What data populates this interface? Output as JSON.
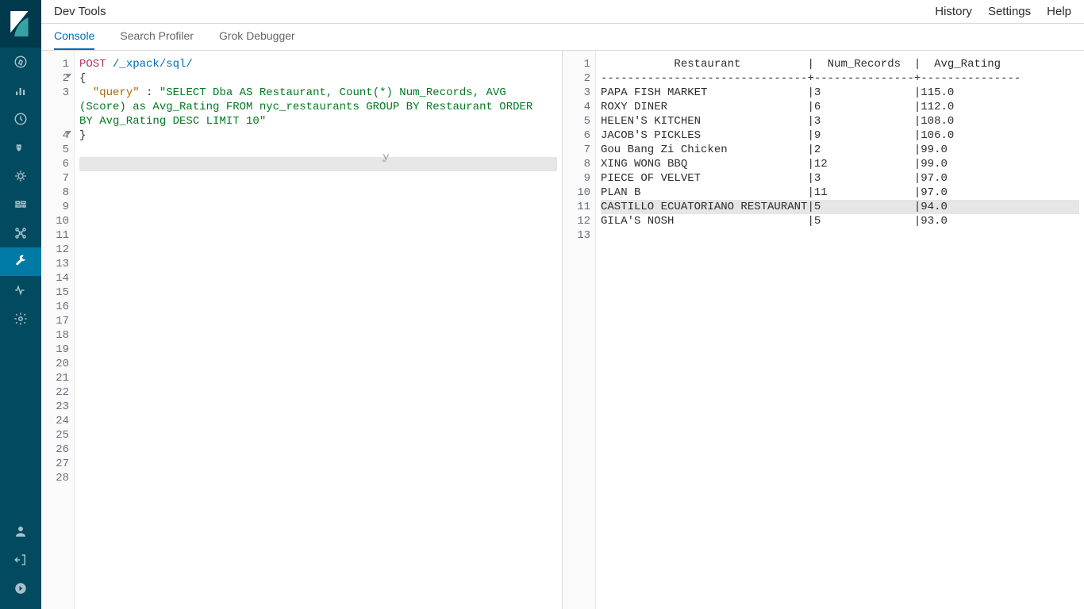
{
  "header": {
    "title": "Dev Tools",
    "links": {
      "history": "History",
      "settings": "Settings",
      "help": "Help"
    }
  },
  "tabs": {
    "console": "Console",
    "search_profiler": "Search Profiler",
    "grok_debugger": "Grok Debugger",
    "active": "console"
  },
  "editor": {
    "method": "POST",
    "path": "/_xpack/sql/",
    "body_open": "{",
    "body_key": "\"query\"",
    "body_sep": " : ",
    "body_value_1": "\"SELECT Dba AS Restaurant, Count(*) Num_Records, AVG",
    "body_value_2": "(Score) as Avg_Rating FROM nyc_restaurants GROUP BY Restaurant ORDER",
    "body_value_3": "BY Avg_Rating DESC LIMIT 10\"",
    "body_close": "}",
    "total_lines": 28,
    "highlighted_line": 6
  },
  "output": {
    "header_line": "           Restaurant          |  Num_Records  |  Avg_Rating   ",
    "divider_line": "-------------------------------+---------------+---------------",
    "rows": [
      {
        "restaurant": "PAPA FISH MARKET",
        "num": "3",
        "avg": "115.0"
      },
      {
        "restaurant": "ROXY DINER",
        "num": "6",
        "avg": "112.0"
      },
      {
        "restaurant": "HELEN'S KITCHEN",
        "num": "3",
        "avg": "108.0"
      },
      {
        "restaurant": "JACOB'S PICKLES",
        "num": "9",
        "avg": "106.0"
      },
      {
        "restaurant": "Gou Bang Zi Chicken",
        "num": "2",
        "avg": "99.0"
      },
      {
        "restaurant": "XING WONG BBQ",
        "num": "12",
        "avg": "99.0"
      },
      {
        "restaurant": "PIECE OF VELVET",
        "num": "3",
        "avg": "97.0"
      },
      {
        "restaurant": "PLAN B",
        "num": "11",
        "avg": "97.0"
      },
      {
        "restaurant": "CASTILLO ECUATORIANO RESTAURANT",
        "num": "5",
        "avg": "94.0"
      },
      {
        "restaurant": "GILA'S NOSH",
        "num": "5",
        "avg": "93.0"
      }
    ],
    "highlighted_row_index": 8,
    "total_lines": 13,
    "col1_width": 31,
    "col2_width": 15
  },
  "sidebar": {
    "items": [
      {
        "name": "discover-icon"
      },
      {
        "name": "visualize-icon"
      },
      {
        "name": "dashboard-icon"
      },
      {
        "name": "timelion-icon"
      },
      {
        "name": "apm-icon"
      },
      {
        "name": "canvas-icon"
      },
      {
        "name": "ml-icon"
      },
      {
        "name": "devtools-icon",
        "active": true
      },
      {
        "name": "monitoring-icon"
      },
      {
        "name": "management-icon"
      }
    ],
    "bottom": [
      {
        "name": "user-icon"
      },
      {
        "name": "logout-icon"
      },
      {
        "name": "collapse-icon"
      }
    ]
  }
}
